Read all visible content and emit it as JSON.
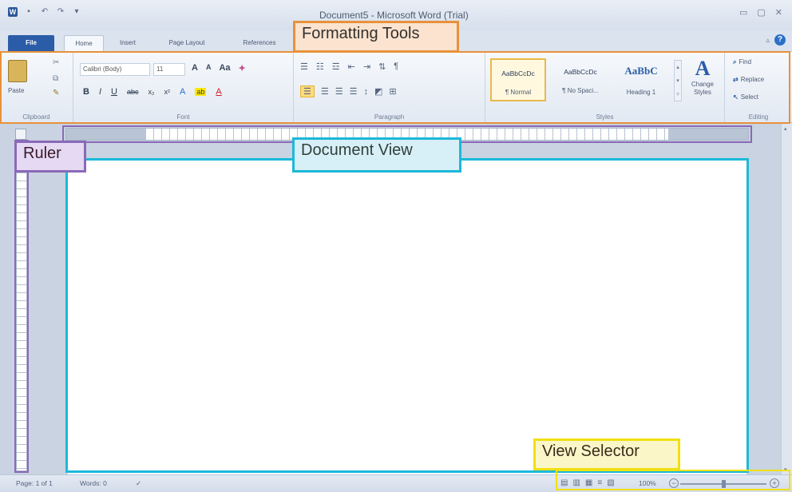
{
  "title_bar": {
    "title": "Document5 - Microsoft Word (Trial)",
    "quick_access": [
      "word-logo-icon",
      "save-icon",
      "undo-icon",
      "redo-icon",
      "customize-icon"
    ]
  },
  "tabs": [
    {
      "label": "File"
    },
    {
      "label": "Home"
    },
    {
      "label": "Insert"
    },
    {
      "label": "Page Layout"
    },
    {
      "label": "References"
    }
  ],
  "ribbon": {
    "clipboard": {
      "label": "Clipboard",
      "paste": "Paste"
    },
    "font": {
      "label": "Font",
      "font_name": "Calibri (Body)",
      "font_size": "11",
      "grow": "A",
      "shrink": "A",
      "case": "Aa",
      "bold": "B",
      "italic": "I",
      "underline": "U",
      "strike": "abc",
      "subscript": "x₂",
      "superscript": "x²",
      "highlight": "ab",
      "font_color": "A"
    },
    "paragraph": {
      "label": "Paragraph"
    },
    "styles": {
      "label": "Styles",
      "items": [
        {
          "sample": "AaBbCcDc",
          "name": "¶ Normal"
        },
        {
          "sample": "AaBbCcDc",
          "name": "¶ No Spaci..."
        },
        {
          "sample": "AaBbC",
          "name": "Heading 1"
        }
      ],
      "change_styles": "Change Styles"
    },
    "editing": {
      "label": "Editing",
      "find": "Find",
      "replace": "Replace",
      "select": "Select"
    }
  },
  "status_bar": {
    "page": "Page: 1 of 1",
    "words": "Words: 0",
    "zoom": "100%"
  },
  "annotations": {
    "formatting_tools": "Formatting Tools",
    "ruler": "Ruler",
    "document_view": "Document View",
    "view_selector": "View Selector"
  },
  "colors": {
    "formatting_tools": "#e8913a",
    "ruler": "#8a69b8",
    "document_view": "#1bb9d9",
    "view_selector": "#f0e010"
  }
}
